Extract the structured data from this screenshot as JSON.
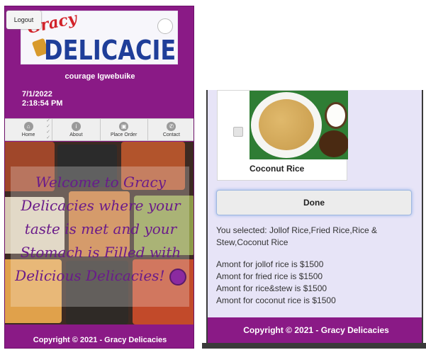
{
  "left": {
    "logout_label": "Logout",
    "logo": {
      "script_text": "Gracy",
      "main_text": "DELICACIES"
    },
    "username": "courage Igwebuike",
    "date": "7/1/2022",
    "time": "2:18:54 PM",
    "nav": [
      {
        "label": "Home",
        "icon": "home-icon"
      },
      {
        "label": "About",
        "icon": "info-icon"
      },
      {
        "label": "Place Order",
        "icon": "bag-icon"
      },
      {
        "label": "Contact",
        "icon": "phone-icon"
      }
    ],
    "welcome_text": "Welcome to Gracy Delicacies where your taste is met and your Stomach is Filled with Delicious Delicacies!",
    "footer": "Copyright © 2021 - Gracy Delicacies"
  },
  "right": {
    "item_caption": "Coconut Rice",
    "done_label": "Done",
    "selected_text": "You selected: Jollof Rice,Fried Rice,Rice & Stew,Coconut Rice",
    "amounts": [
      "Amont for jollof rice is $1500",
      "Amont for fried rice is $1500",
      "Amont for rice&stew is $1500",
      "Amont for coconut rice is $1500"
    ],
    "footer": "Copyright © 2021 - Gracy Delicacies"
  },
  "colors": {
    "brand_purple": "#8a1a86",
    "background_lavender": "#e7e4f7"
  }
}
